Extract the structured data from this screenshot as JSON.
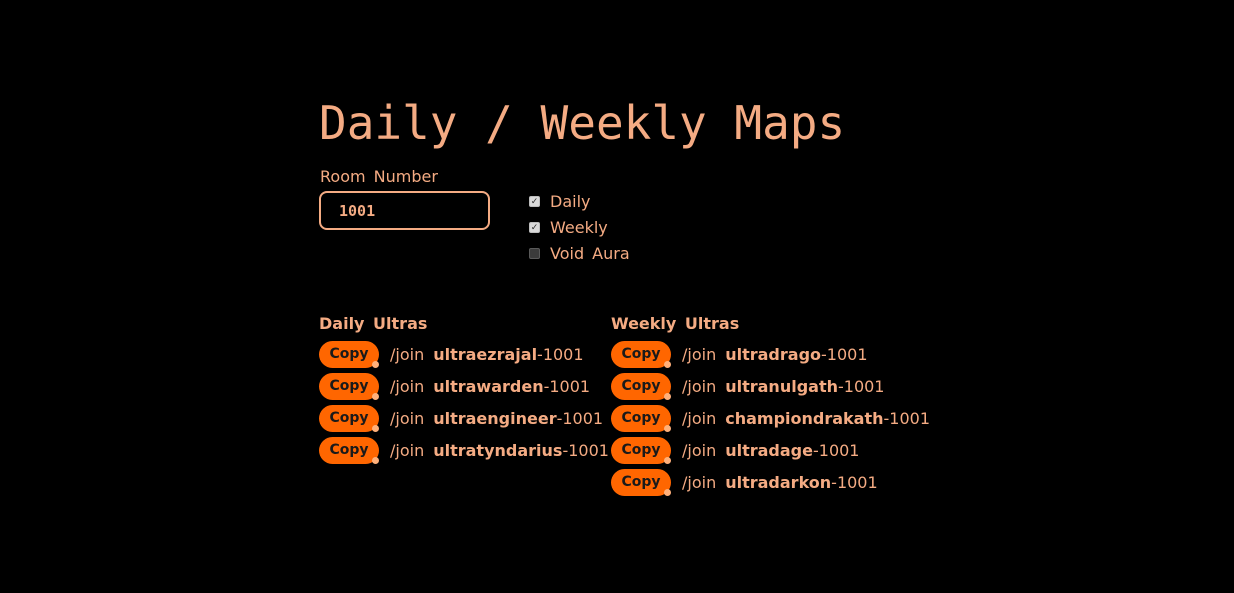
{
  "title": "Daily / Weekly Maps",
  "room": {
    "label": "Room Number",
    "value": "1001"
  },
  "options": [
    {
      "label": "Daily",
      "checked": true
    },
    {
      "label": "Weekly",
      "checked": true
    },
    {
      "label": "Void Aura",
      "checked": false
    }
  ],
  "daily": {
    "heading": "Daily Ultras",
    "items": [
      {
        "copy": "Copy",
        "cmd": "/join",
        "map": "ultraezrajal",
        "suffix": "-1001"
      },
      {
        "copy": "Copy",
        "cmd": "/join",
        "map": "ultrawarden",
        "suffix": "-1001"
      },
      {
        "copy": "Copy",
        "cmd": "/join",
        "map": "ultraengineer",
        "suffix": "-1001"
      },
      {
        "copy": "Copy",
        "cmd": "/join",
        "map": "ultratyndarius",
        "suffix": "-1001"
      }
    ]
  },
  "weekly": {
    "heading": "Weekly Ultras",
    "items": [
      {
        "copy": "Copy",
        "cmd": "/join",
        "map": "ultradrago",
        "suffix": "-1001"
      },
      {
        "copy": "Copy",
        "cmd": "/join",
        "map": "ultranulgath",
        "suffix": "-1001"
      },
      {
        "copy": "Copy",
        "cmd": "/join",
        "map": "championdrakath",
        "suffix": "-1001"
      },
      {
        "copy": "Copy",
        "cmd": "/join",
        "map": "ultradage",
        "suffix": "-1001"
      },
      {
        "copy": "Copy",
        "cmd": "/join",
        "map": "ultradarkon",
        "suffix": "-1001"
      }
    ]
  },
  "colors": {
    "background": "#000000",
    "text": "#f4ab83",
    "button": "#ff6600"
  }
}
